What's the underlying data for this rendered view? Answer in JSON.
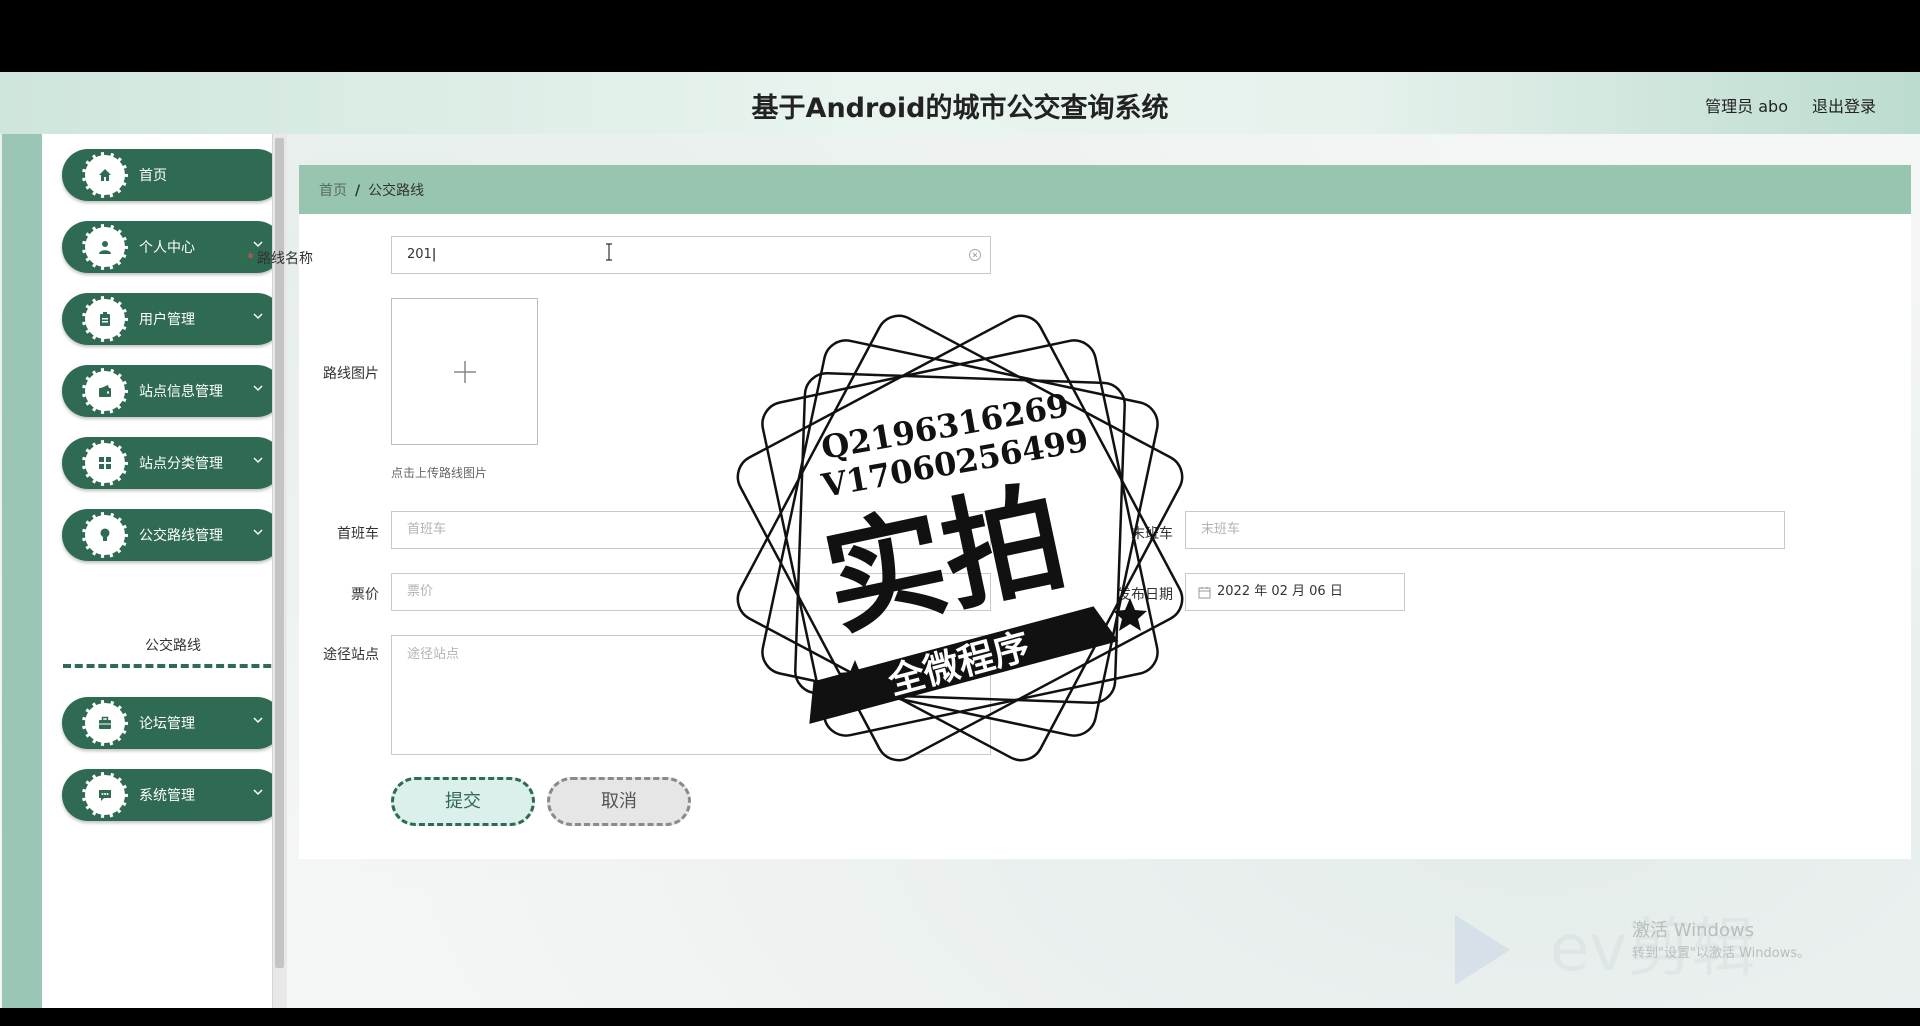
{
  "header": {
    "title": "基于Android的城市公交查询系统",
    "admin": "管理员 abo",
    "logout": "退出登录"
  },
  "sidebar": {
    "items": [
      {
        "label": "首页",
        "icon": "home-icon"
      },
      {
        "label": "个人中心",
        "icon": "user-icon"
      },
      {
        "label": "用户管理",
        "icon": "clipboard-icon"
      },
      {
        "label": "站点信息管理",
        "icon": "wallet-icon"
      },
      {
        "label": "站点分类管理",
        "icon": "grid-icon"
      },
      {
        "label": "公交路线管理",
        "icon": "bulb-icon"
      },
      {
        "label": "论坛管理",
        "icon": "briefcase-icon"
      },
      {
        "label": "系统管理",
        "icon": "chat-icon"
      }
    ],
    "submenu": "公交路线"
  },
  "breadcrumb": {
    "home": "首页",
    "separator": "/",
    "current": "公交路线"
  },
  "form": {
    "route_name": {
      "label": "路线名称",
      "value": "201",
      "required": "*"
    },
    "route_image": {
      "label": "路线图片",
      "hint": "点击上传路线图片"
    },
    "first_bus": {
      "label": "首班车",
      "placeholder": "首班车"
    },
    "last_bus": {
      "label": "末班车",
      "placeholder": "末班车"
    },
    "fare": {
      "label": "票价",
      "placeholder": "票价"
    },
    "publish_date": {
      "label": "发布日期",
      "value": "2022 年 02 月 06 日"
    },
    "via_stations": {
      "label": "途径站点",
      "placeholder": "途径站点"
    },
    "submit": "提交",
    "cancel": "取消"
  },
  "stamp": {
    "line1": "Q2196316269",
    "line2": "V17060256499",
    "main": "实拍",
    "ribbon": "全微程序"
  },
  "watermark": {
    "activate": "激活 Windows",
    "activate_sub": "转到\"设置\"以激活 Windows。",
    "brand": "ev剪辑"
  },
  "colors": {
    "primary": "#2f6b52",
    "breadcrumb_bg": "#97c5b0",
    "strip": "#9bc5b4"
  }
}
